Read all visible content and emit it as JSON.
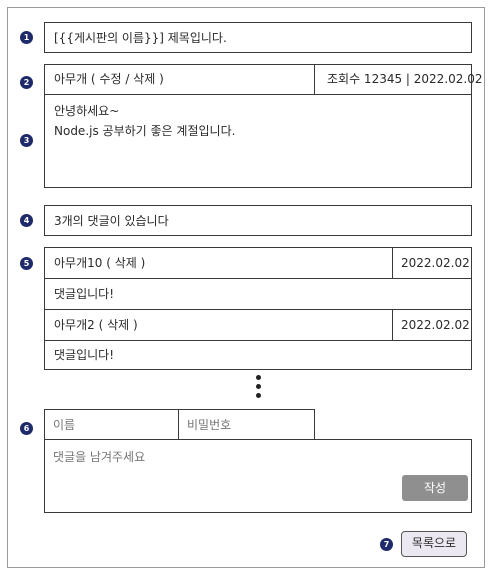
{
  "markers": [
    "1",
    "2",
    "3",
    "4",
    "5",
    "6",
    "7"
  ],
  "post": {
    "title": "[{{게시판의 이름}}] 제목입니다.",
    "author_line": "아무개 ( 수정 / 삭제 )",
    "meta": "조회수 12345 | 2022.02.02",
    "body_line1": "안녕하세요~",
    "body_line2": "Node.js 공부하기 좋은 계절입니다."
  },
  "comments_header": "3개의 댓글이 있습니다",
  "comments": [
    {
      "author": "아무개10 ( 삭제 )",
      "date": "2022.02.02",
      "text": "댓글입니다!"
    },
    {
      "author": "아무개2 ( 삭제 )",
      "date": "2022.02.02",
      "text": "댓글입니다!"
    }
  ],
  "form": {
    "name_placeholder": "이름",
    "password_placeholder": "비밀번호",
    "comment_placeholder": "댓글을 남겨주세요",
    "submit_label": "작성"
  },
  "back_label": "목록으로",
  "colors": {
    "marker": "#1f2a6b",
    "submit_bg": "#8f8f8f",
    "back_bg": "#ece8f2"
  }
}
